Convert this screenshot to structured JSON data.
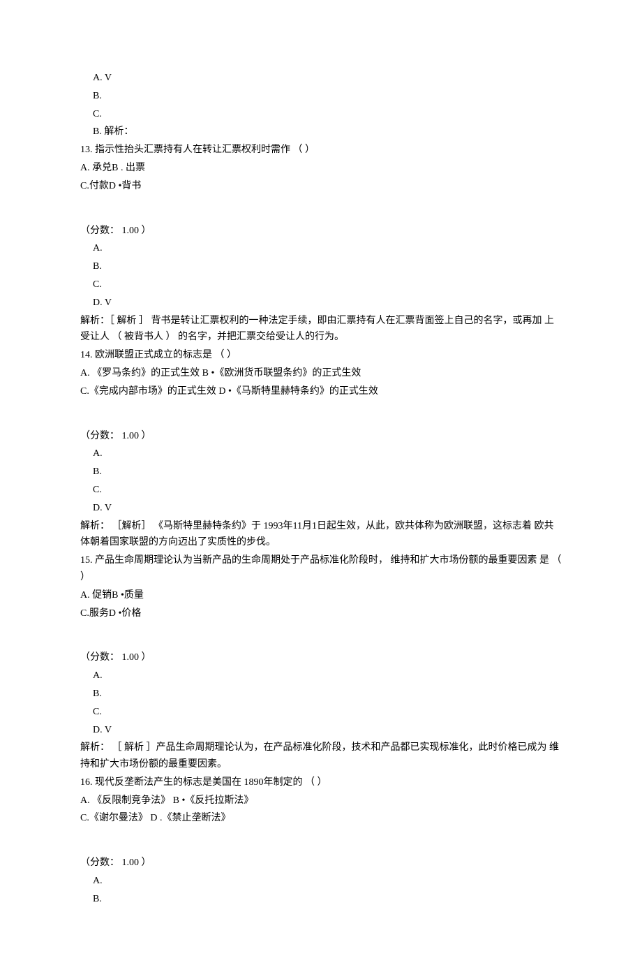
{
  "q12": {
    "optA": "A. V",
    "optB": "B.",
    "optC": "C.",
    "ansLabel": "B.   解析：",
    "endSpacer": ""
  },
  "q13": {
    "stem": "13.  指示性抬头汇票持有人在转让汇票权利时需作 （ ）",
    "optLine1": "A.     承兑B . 出票",
    "optLine2": "C.付款D •背书",
    "score": "（分数：  1.00 ）",
    "optA": "A.",
    "optB": "B.",
    "optC": "C.",
    "optD": "D.    V",
    "analysis": "解析：［ 解析 ］ 背书是转让汇票权利的一种法定手续，即由汇票持有人在汇票背面签上自己的名字，或再加 上受让人 （ 被背书人  ） 的名字，并把汇票交给受让人的行为。"
  },
  "q14": {
    "stem": "14.  欧洲联盟正式成立的标志是 （ ）",
    "optLine1": "A.     《罗马条约》的正式生效 B •《欧洲货币联盟条约》的正式生效",
    "optLine2": "C.《完成内部市场》的正式生效 D •《马斯特里赫特条约》的正式生效",
    "score": "（分数：  1.00 ）",
    "optA": "A.",
    "optB": "B.",
    "optC": "C.",
    "optD": "D.    V",
    "analysis": "解析：  ［解析］ 《马斯特里赫特条约》于 1993年11月1日起生效，从此，欧共体称为欧洲联盟，这标志着 欧共体朝着国家联盟的方向迈出了实质性的步伐。"
  },
  "q15": {
    "stem": "15.  产品生命周期理论认为当新产品的生命周期处于产品标准化阶段时，  维持和扩大市场份额的最重要因素  是 （ ）",
    "optLine1": "A.     促销B •质量",
    "optLine2": "C.服务D •价格",
    "score": "（分数：  1.00 ）",
    "optA": "A.",
    "optB": "B.",
    "optC": "C.",
    "optD": "D.    V",
    "analysis": "解析：   ［ 解析  ］产品生命周期理论认为，在产品标准化阶段，技术和产品都已实现标准化，此时价格已成为 维持和扩大市场份额的最重要因素。"
  },
  "q16": {
    "stem": "16.  现代反垄断法产生的标志是美国在 1890年制定的 （ ）",
    "optLine1": "A.                               《反限制竞争法》  B •《反托拉斯法》",
    "optLine2": "C.《谢尔曼法》  D .《禁止垄断法》",
    "score": "（分数：  1.00 ）",
    "optA": "A.",
    "optB": "B."
  }
}
